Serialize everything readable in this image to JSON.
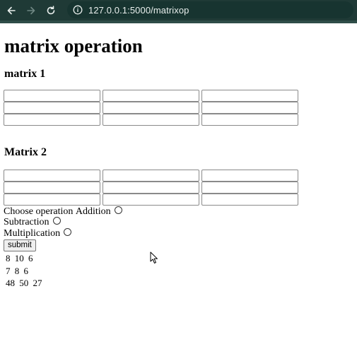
{
  "browser": {
    "url": "127.0.0.1:5000/matrixop"
  },
  "page": {
    "title": "matrix operation",
    "matrix1": {
      "title": "matrix 1"
    },
    "matrix2": {
      "title": "Matrix 2"
    },
    "operation": {
      "prompt": "Choose operation",
      "options": [
        "Addition",
        "Subtraction",
        "Multiplication"
      ]
    },
    "submit_label": "submit",
    "result": {
      "rows": [
        [
          "8",
          "10",
          "6"
        ],
        [
          "7",
          "8",
          "6"
        ],
        [
          "48",
          "50",
          "27"
        ]
      ]
    }
  },
  "icons": {
    "back": "arrow-left-icon",
    "forward": "arrow-right-icon",
    "reload": "reload-icon",
    "info": "info-icon",
    "cursor": "mouse-pointer-icon"
  },
  "colors": {
    "chrome_bg": "#1f3a36",
    "url_box_bg": "#173430",
    "chrome_text": "#e8eeec"
  }
}
